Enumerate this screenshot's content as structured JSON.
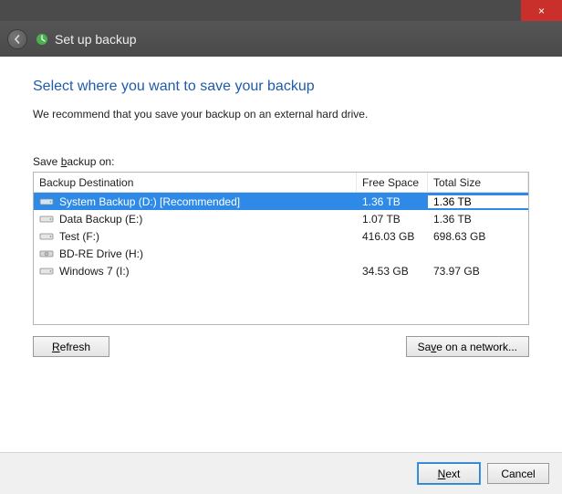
{
  "titlebar": {
    "close_label": "×"
  },
  "nav": {
    "title": "Set up backup"
  },
  "page": {
    "heading": "Select where you want to save your backup",
    "recommend": "We recommend that you save your backup on an external hard drive.",
    "save_on_label_pre": "Save ",
    "save_on_label_u": "b",
    "save_on_label_post": "ackup on:"
  },
  "columns": {
    "destination": "Backup Destination",
    "free": "Free Space",
    "total": "Total Size"
  },
  "drives": [
    {
      "name": "System Backup (D:) [Recommended]",
      "free": "1.36 TB",
      "total": "1.36 TB",
      "icon": "hdd",
      "selected": true
    },
    {
      "name": "Data Backup (E:)",
      "free": "1.07 TB",
      "total": "1.36 TB",
      "icon": "hdd",
      "selected": false
    },
    {
      "name": "Test (F:)",
      "free": "416.03 GB",
      "total": "698.63 GB",
      "icon": "hdd",
      "selected": false
    },
    {
      "name": "BD-RE Drive (H:)",
      "free": "",
      "total": "",
      "icon": "optical",
      "selected": false
    },
    {
      "name": "Windows 7 (I:)",
      "free": "34.53 GB",
      "total": "73.97 GB",
      "icon": "hdd",
      "selected": false
    }
  ],
  "buttons": {
    "refresh_u": "R",
    "refresh_post": "efresh",
    "network_pre": "Sa",
    "network_u": "v",
    "network_post": "e on a network...",
    "next_u": "N",
    "next_post": "ext",
    "cancel": "Cancel"
  }
}
